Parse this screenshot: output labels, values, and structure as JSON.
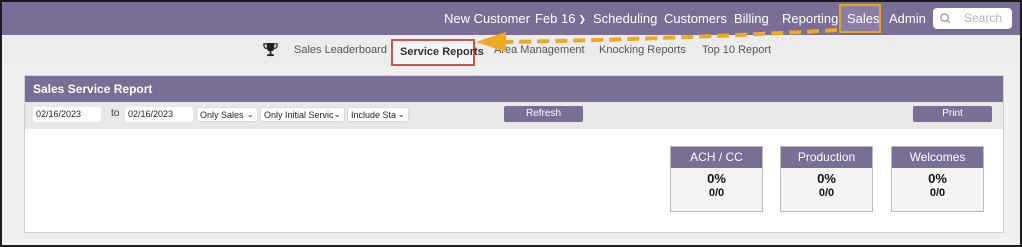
{
  "topnav": {
    "items": [
      "New Customer",
      "Feb 16",
      "Scheduling",
      "Customers",
      "Billing",
      "Reporting",
      "Sales",
      "Admin"
    ],
    "search_placeholder": "Search"
  },
  "subnav": {
    "links": [
      "Sales Leaderboard",
      "Service Reports",
      "Area Management",
      "Knocking Reports",
      "Top 10 Report"
    ]
  },
  "report": {
    "title": "Sales Service Report",
    "from_date": "02/16/2023",
    "to_label": "to",
    "to_date": "02/16/2023",
    "filter_sales": "Only Sales",
    "filter_service": "Only Initial Servic",
    "filter_status": "Include Sta",
    "refresh_label": "Refresh",
    "print_label": "Print"
  },
  "cards": [
    {
      "title": "ACH / CC",
      "percent": "0%",
      "ratio": "0/0"
    },
    {
      "title": "Production",
      "percent": "0%",
      "ratio": "0/0"
    },
    {
      "title": "Welcomes",
      "percent": "0%",
      "ratio": "0/0"
    }
  ],
  "colors": {
    "nav": "#7a6e97",
    "highlight_orange": "#e8a31c",
    "highlight_red": "#d4504a",
    "arrow": "#f0a820"
  }
}
